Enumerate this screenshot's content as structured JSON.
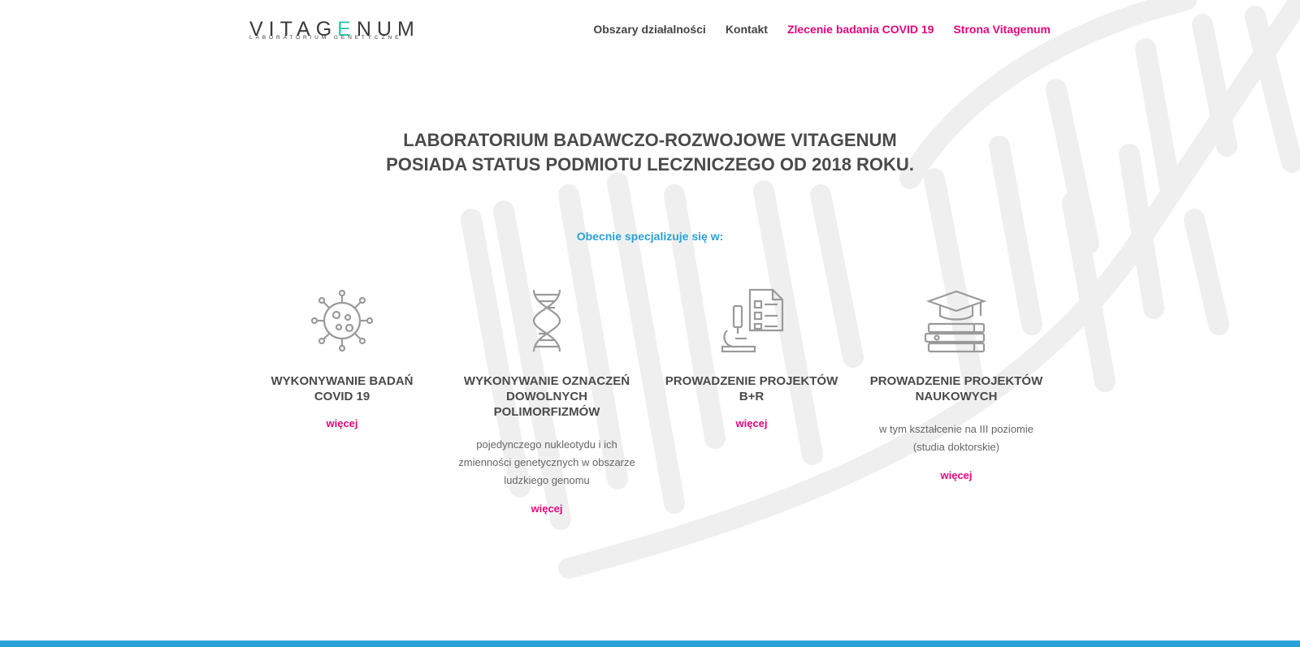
{
  "logo": {
    "main_before": "VITAG",
    "main_accent": "E",
    "main_after": "NUM",
    "sub": "LABORATORIUM GENETYCZNE"
  },
  "nav": [
    {
      "label": "Obszary działalności",
      "accent": false
    },
    {
      "label": "Kontakt",
      "accent": false
    },
    {
      "label": "Zlecenie badania COVID 19",
      "accent": true
    },
    {
      "label": "Strona Vitagenum",
      "accent": true
    }
  ],
  "hero": {
    "line1": "LABORATORIUM BADAWCZO-ROZWOJOWE VITAGENUM",
    "line2": "POSIADA STATUS PODMIOTU LECZNICZEGO OD 2018 ROKU."
  },
  "subheading": "Obecnie specjalizuje się w:",
  "cards": [
    {
      "icon": "virus-icon",
      "title_line1": "WYKONYWANIE BADAŃ",
      "title_line2": "COVID 19",
      "desc": [],
      "more": "więcej"
    },
    {
      "icon": "dna-icon",
      "title_line1": "WYKONYWANIE OZNACZEŃ",
      "title_line2": "DOWOLNYCH POLIMORFIZMÓW",
      "desc": [
        "pojedynczego nukleotydu i ich",
        "zmienności genetycznych w obszarze",
        "ludzkiego genomu"
      ],
      "more": "więcej"
    },
    {
      "icon": "microscope-icon",
      "title_line1": "PROWADZENIE PROJEKTÓW B+R",
      "title_line2": "",
      "desc": [],
      "more": "więcej"
    },
    {
      "icon": "graduation-cap-icon",
      "title_line1": "PROWADZENIE PROJEKTÓW",
      "title_line2": "NAUKOWYCH",
      "desc": [
        "w tym kształcenie na III poziomie",
        "(studia doktorskie)"
      ],
      "more": "więcej"
    }
  ],
  "colors": {
    "accent_pink": "#e2077c",
    "accent_blue": "#2aa1d8",
    "text": "#4a4a4a",
    "logo_accent": "#2ec4a8"
  }
}
